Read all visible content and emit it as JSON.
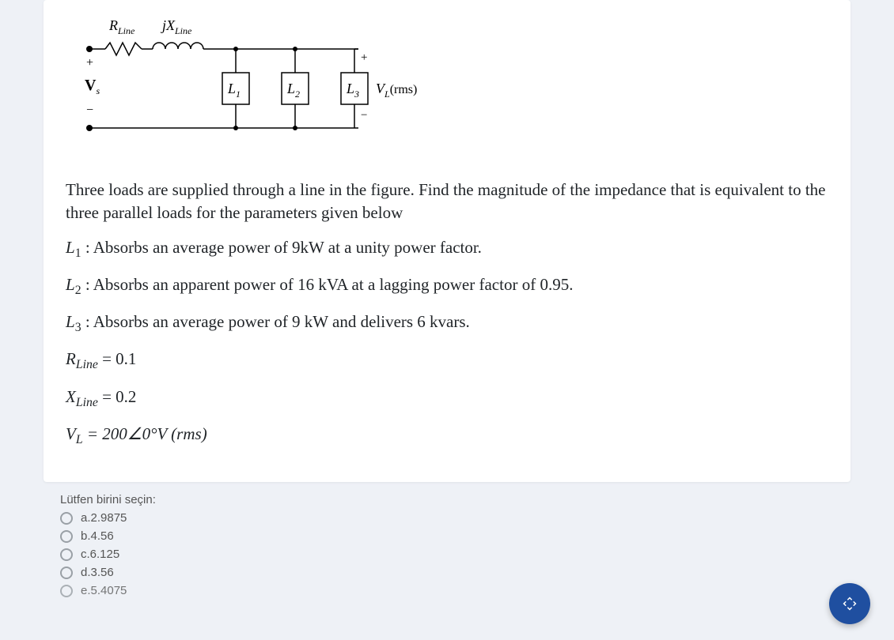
{
  "diagram": {
    "Rline_label_base": "R",
    "Rline_label_sub": "Line",
    "Xline_label_pre": "jX",
    "Xline_label_sub": "Line",
    "Vs_label_base": "V",
    "Vs_label_sub": "s",
    "plus": "+",
    "minus": "−",
    "L1": "L",
    "L1sub": "1",
    "L2": "L",
    "L2sub": "2",
    "L3": "L",
    "L3sub": "3",
    "VL_base": "V",
    "VL_sub": "L",
    "VL_rest": "(rms)"
  },
  "text": {
    "intro": "Three loads are supplied through a line in the figure. Find the magnitude of the impedance that is equivalent to the three parallel loads for the parameters given below",
    "L1_pre": "L",
    "L1_sub": "1",
    "L1_rest": " : Absorbs an average power of 9kW at a unity power factor.",
    "L2_pre": "L",
    "L2_sub": "2",
    "L2_rest": " :  Absorbs an apparent power of 16 kVA at a lagging power factor of 0.95.",
    "L3_pre": "L",
    "L3_sub": "3",
    "L3_rest": " :  Absorbs an average power of 9 kW and delivers 6 kvars.",
    "Rline_eq_pre": "R",
    "Rline_eq_sub": "Line",
    "Rline_eq_rest": " = 0.1",
    "Xline_eq_pre": "X",
    "Xline_eq_sub": "Line",
    "Xline_eq_rest": " = 0.2",
    "VL_eq_pre": "V",
    "VL_eq_sub": "L",
    "VL_eq_rest": " = 200∠0°V (rms)"
  },
  "choices": {
    "title": "Lütfen birini seçin:",
    "items": [
      {
        "label": "a.2.9875"
      },
      {
        "label": "b.4.56"
      },
      {
        "label": "c.6.125"
      },
      {
        "label": "d.3.56"
      },
      {
        "label": "e.5.4075"
      }
    ]
  },
  "fab": {
    "icon": "expand-icon"
  }
}
